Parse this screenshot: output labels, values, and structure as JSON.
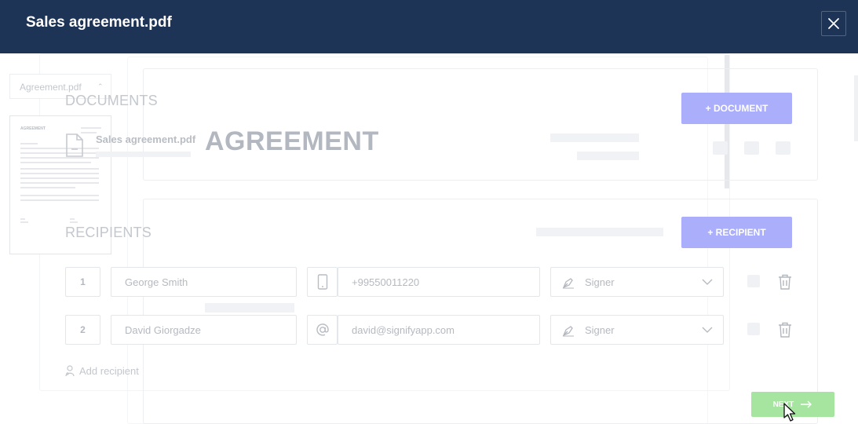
{
  "header": {
    "title": "Sales agreement.pdf"
  },
  "file_select": {
    "value": "Agreement.pdf"
  },
  "thumbnail": {
    "title": "AGREEMENT"
  },
  "documents": {
    "heading": "DOCUMENTS",
    "add_button": "+ DOCUMENT",
    "item": {
      "name": "Sales agreement.pdf",
      "preview_title": "AGREEMENT"
    }
  },
  "recipients": {
    "heading": "RECIPIENTS",
    "add_button": "+ RECIPIENT",
    "rows": [
      {
        "index": "1",
        "name": "George Smith",
        "contact_icon": "phone-icon",
        "contact": "+99550011220",
        "role": "Signer"
      },
      {
        "index": "2",
        "name": "David Giorgadze",
        "contact_icon": "at-icon",
        "contact": "david@signifyapp.com",
        "role": "Signer"
      }
    ],
    "add_link": "Add recipient"
  },
  "footer": {
    "next_label": "NEXT"
  },
  "colors": {
    "header_bg": "#1e3456",
    "accent_purple": "#aaaefb",
    "next_green": "#a6e59f"
  }
}
